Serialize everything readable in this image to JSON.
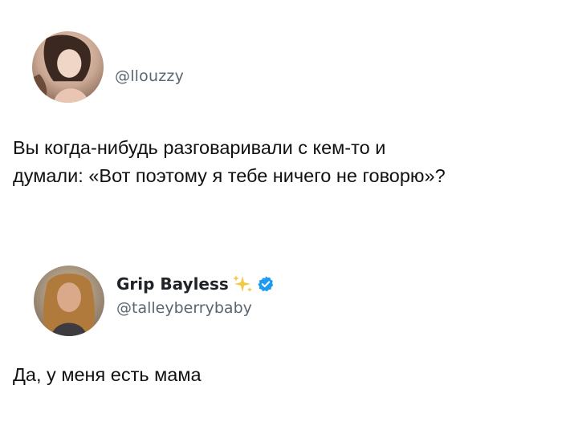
{
  "posts": [
    {
      "handle": "@llouzzy",
      "text_lines": [
        "Вы когда-нибудь разговаривали с кем-то и",
        "думали: «Вот поэтому я тебе ничего не говорю»?"
      ]
    },
    {
      "display_name": "Grip Bayless",
      "name_decoration_icon": "sparkles-icon",
      "verified_icon": "verified-badge-icon",
      "verified_color": "#1d9bf0",
      "handle": "@talleyberrybaby",
      "text_lines": [
        "Да, у меня есть мама"
      ]
    }
  ]
}
